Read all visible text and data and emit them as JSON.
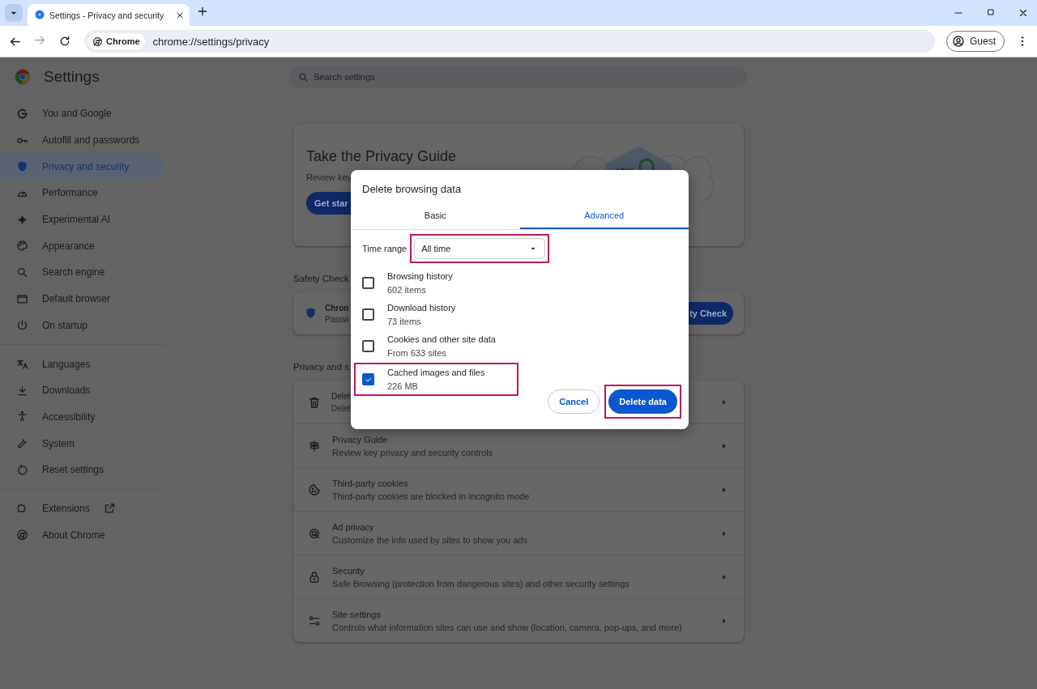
{
  "browser": {
    "tab_title": "Settings - Privacy and security",
    "chip": "Chrome",
    "url": "chrome://settings/privacy",
    "profile": "Guest",
    "forward_disabled": true
  },
  "settings": {
    "title": "Settings",
    "search_placeholder": "Search settings"
  },
  "sidebar": {
    "groups": [
      {
        "items": [
          {
            "label": "You and Google",
            "selected": false
          },
          {
            "label": "Autofill and passwords",
            "selected": false
          },
          {
            "label": "Privacy and security",
            "selected": true
          },
          {
            "label": "Performance",
            "selected": false
          },
          {
            "label": "Experimental AI",
            "selected": false
          },
          {
            "label": "Appearance",
            "selected": false
          },
          {
            "label": "Search engine",
            "selected": false
          },
          {
            "label": "Default browser",
            "selected": false
          },
          {
            "label": "On startup",
            "selected": false
          }
        ]
      },
      {
        "items": [
          {
            "label": "Languages",
            "selected": false
          },
          {
            "label": "Downloads",
            "selected": false
          },
          {
            "label": "Accessibility",
            "selected": false
          },
          {
            "label": "System",
            "selected": false
          },
          {
            "label": "Reset settings",
            "selected": false
          }
        ]
      },
      {
        "items": [
          {
            "label": "Extensions",
            "selected": false,
            "kind": "external"
          },
          {
            "label": "About Chrome",
            "selected": false
          }
        ]
      }
    ]
  },
  "privacy_guide": {
    "title": "Take the Privacy Guide",
    "text": "Review key",
    "button": "Get star"
  },
  "safety_check": {
    "heading": "Safety Check",
    "title": "Chron",
    "text": "Passw",
    "button": "ty Check"
  },
  "privacy_section": {
    "heading": "Privacy and s",
    "rows": [
      {
        "title": "Delet",
        "text": "Delet"
      },
      {
        "title": "Privacy Guide",
        "text": "Review key privacy and security controls"
      },
      {
        "title": "Third-party cookies",
        "text": "Third-party cookies are blocked in Incognito mode"
      },
      {
        "title": "Ad privacy",
        "text": "Customize the info used by sites to show you ads"
      },
      {
        "title": "Security",
        "text": "Safe Browsing (protection from dangerous sites) and other security settings"
      },
      {
        "title": "Site settings",
        "text": "Controls what information sites can use and show (location, camera, pop-ups, and more)"
      }
    ]
  },
  "dialog": {
    "title": "Delete browsing data",
    "tabs": [
      {
        "label": "Basic",
        "selected": false
      },
      {
        "label": "Advanced",
        "selected": true
      }
    ],
    "time_range": {
      "label": "Time range",
      "value": "All time",
      "highlighted": true
    },
    "options": [
      {
        "label": "Browsing history",
        "detail": "602 items",
        "checked": false,
        "highlighted": false
      },
      {
        "label": "Download history",
        "detail": "73 items",
        "checked": false,
        "highlighted": false
      },
      {
        "label": "Cookies and other site data",
        "detail": "From 633 sites",
        "checked": false,
        "highlighted": false
      },
      {
        "label": "Cached images and files",
        "detail": "226 MB",
        "checked": true,
        "highlighted": true
      }
    ],
    "buttons": [
      {
        "label": "Cancel",
        "kind": "secondary",
        "highlighted": false
      },
      {
        "label": "Delete data",
        "kind": "primary",
        "highlighted": true
      }
    ]
  }
}
